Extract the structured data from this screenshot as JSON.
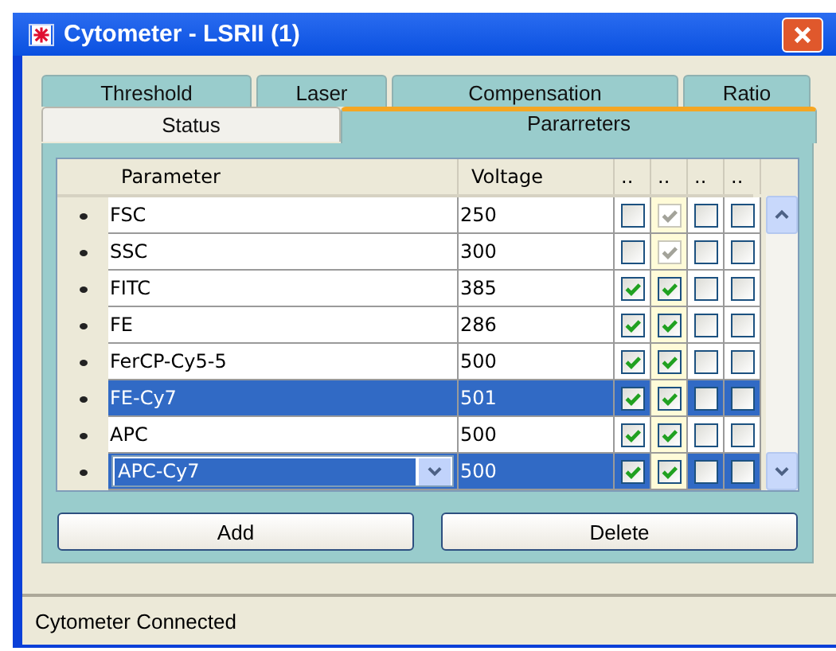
{
  "window": {
    "title": "Cytometer - LSRII (1)"
  },
  "tabs_row_1": [
    {
      "label": "Threshold",
      "selected": false
    },
    {
      "label": "Laser",
      "selected": false
    },
    {
      "label": "Compensation",
      "selected": false
    },
    {
      "label": "Ratio",
      "selected": false
    }
  ],
  "tabs_row_2": [
    {
      "label": "Status",
      "selected": false
    },
    {
      "label": "Pararreters",
      "selected": true
    }
  ],
  "table": {
    "columns": [
      "Parameter",
      "Voltage",
      "..",
      "..",
      "..",
      ".."
    ],
    "rows": [
      {
        "kind": "text",
        "parameter": "FSC",
        "voltage": "250",
        "selected": false,
        "checks": [
          {
            "checked": false,
            "disabled": false
          },
          {
            "checked": true,
            "disabled": true
          },
          {
            "checked": false,
            "disabled": false
          },
          {
            "checked": false,
            "disabled": false
          }
        ]
      },
      {
        "kind": "text",
        "parameter": "SSC",
        "voltage": "300",
        "selected": false,
        "checks": [
          {
            "checked": false,
            "disabled": false
          },
          {
            "checked": true,
            "disabled": true
          },
          {
            "checked": false,
            "disabled": false
          },
          {
            "checked": false,
            "disabled": false
          }
        ]
      },
      {
        "kind": "text",
        "parameter": "FITC",
        "voltage": "385",
        "selected": false,
        "checks": [
          {
            "checked": true,
            "disabled": false
          },
          {
            "checked": true,
            "disabled": false
          },
          {
            "checked": false,
            "disabled": false
          },
          {
            "checked": false,
            "disabled": false
          }
        ]
      },
      {
        "kind": "text",
        "parameter": "FE",
        "voltage": "286",
        "selected": false,
        "checks": [
          {
            "checked": true,
            "disabled": false
          },
          {
            "checked": true,
            "disabled": false
          },
          {
            "checked": false,
            "disabled": false
          },
          {
            "checked": false,
            "disabled": false
          }
        ]
      },
      {
        "kind": "text",
        "parameter": "FerCP-Cy5-5",
        "voltage": "500",
        "selected": false,
        "checks": [
          {
            "checked": true,
            "disabled": false
          },
          {
            "checked": true,
            "disabled": false
          },
          {
            "checked": false,
            "disabled": false
          },
          {
            "checked": false,
            "disabled": false
          }
        ]
      },
      {
        "kind": "text",
        "parameter": "FE-Cy7",
        "voltage": "501",
        "selected": true,
        "checks": [
          {
            "checked": true,
            "disabled": false
          },
          {
            "checked": true,
            "disabled": false
          },
          {
            "checked": false,
            "disabled": false
          },
          {
            "checked": false,
            "disabled": false
          }
        ]
      },
      {
        "kind": "text",
        "parameter": "APC",
        "voltage": "500",
        "selected": false,
        "checks": [
          {
            "checked": true,
            "disabled": false
          },
          {
            "checked": true,
            "disabled": false
          },
          {
            "checked": false,
            "disabled": false
          },
          {
            "checked": false,
            "disabled": false
          }
        ]
      },
      {
        "kind": "dropdown",
        "parameter": "APC-Cy7",
        "voltage": "500",
        "selected": true,
        "checks": [
          {
            "checked": true,
            "disabled": false
          },
          {
            "checked": true,
            "disabled": false
          },
          {
            "checked": false,
            "disabled": false
          },
          {
            "checked": false,
            "disabled": false
          }
        ]
      }
    ]
  },
  "buttons": [
    "Add",
    "Delete"
  ],
  "status_bar": "Cytometer Connected"
}
